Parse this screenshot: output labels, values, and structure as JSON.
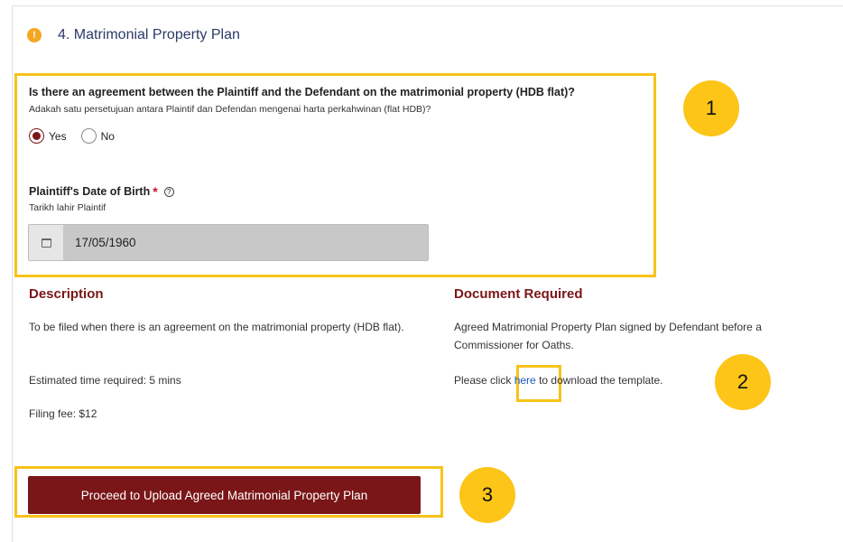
{
  "section": {
    "icon": "warning-icon",
    "icon_glyph": "!",
    "title": "4. Matrimonial Property Plan"
  },
  "question": {
    "text": "Is there an agreement between the Plaintiff and the Defendant on the matrimonial property (HDB flat)?",
    "subtext": "Adakah satu persetujuan antara Plaintif dan Defendan mengenai harta perkahwinan (flat HDB)?",
    "options": [
      {
        "label": "Yes",
        "selected": true
      },
      {
        "label": "No",
        "selected": false
      }
    ]
  },
  "dob": {
    "label": "Plaintiff's Date of Birth",
    "required_mark": "*",
    "help_glyph": "?",
    "subtext": "Tarikh lahir Plaintif",
    "value": "17/05/1960",
    "icon": "calendar-icon"
  },
  "description": {
    "title": "Description",
    "text": "To be filed when there is an agreement on the matrimonial property (HDB flat).",
    "time": "Estimated time required: 5 mins",
    "fee": "Filing fee: $12"
  },
  "document": {
    "title": "Document Required",
    "text": "Agreed Matrimonial Property Plan signed by Defendant before a Commissioner for Oaths.",
    "download_prefix": "Please click ",
    "download_link": "here",
    "download_suffix": " to download the template."
  },
  "proceed_button": {
    "label": "Proceed to Upload Agreed Matrimonial Property Plan"
  },
  "callouts": [
    "1",
    "2",
    "3"
  ],
  "colors": {
    "accent": "#7a1618",
    "highlight": "#f7c31a",
    "callout": "#fcc517",
    "link": "#1a56c4",
    "title": "#2b3a67"
  }
}
